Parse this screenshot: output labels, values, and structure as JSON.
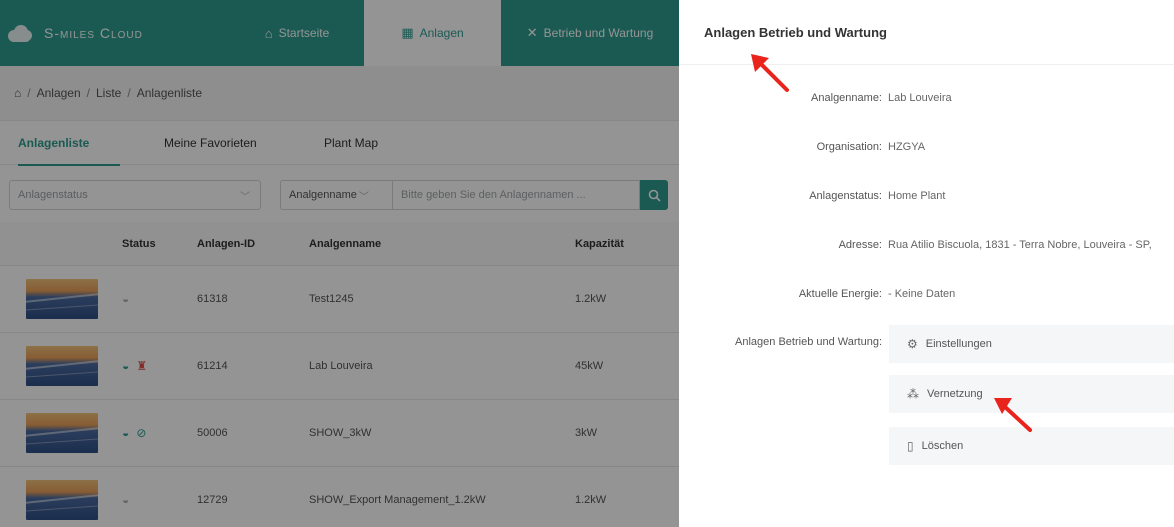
{
  "nav": {
    "brand": "S-miles Cloud",
    "home": "Startseite",
    "plants": "Anlagen",
    "ops": "Betrieb und Wartung"
  },
  "breadcrumb": [
    "Anlagen",
    "Liste",
    "Anlagenliste"
  ],
  "tabs": [
    "Anlagenliste",
    "Meine Favorieten",
    "Plant Map"
  ],
  "filters": {
    "status_placeholder": "Anlagenstatus",
    "search_type": "Analgenname",
    "search_placeholder": "Bitte geben Sie den Anlagennamen ..."
  },
  "table": {
    "headers": [
      "Status",
      "Anlagen-ID",
      "Analgenname",
      "Kapazität"
    ],
    "rows": [
      {
        "id": "61318",
        "name": "Test1245",
        "capacity": "1.2kW"
      },
      {
        "id": "61214",
        "name": "Lab Louveira",
        "capacity": "45kW"
      },
      {
        "id": "50006",
        "name": "SHOW_3kW",
        "capacity": "3kW"
      },
      {
        "id": "12729",
        "name": "SHOW_Export Management_1.2kW",
        "capacity": "1.2kW"
      }
    ]
  },
  "drawer": {
    "title": "Anlagen Betrieb und Wartung",
    "fields": [
      {
        "label": "Analgenname:",
        "value": "Lab Louveira"
      },
      {
        "label": "Organisation:",
        "value": "HZGYA"
      },
      {
        "label": "Anlagenstatus:",
        "value": "Home Plant"
      },
      {
        "label": "Adresse:",
        "value": "Rua Atilio Biscuola, 1831 - Terra Nobre, Louveira - SP,"
      },
      {
        "label": "Aktuelle Energie:",
        "value": "- Keine Daten"
      }
    ],
    "ops_label": "Anlagen Betrieb und Wartung:",
    "ops_buttons": [
      "Einstellungen",
      "Vernetzung",
      "Löschen"
    ]
  },
  "colors": {
    "brand": "#2e9c8f",
    "annotation": "#e8241d"
  }
}
